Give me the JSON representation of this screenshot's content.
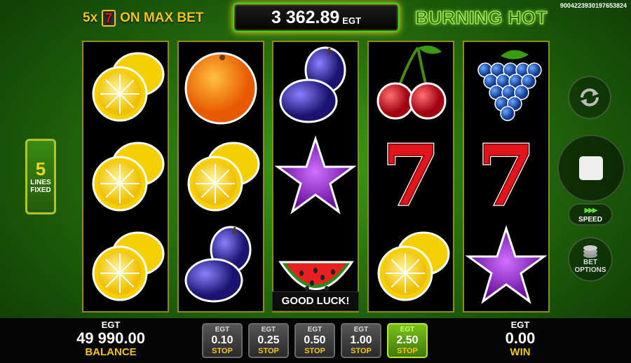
{
  "header": {
    "max_bet_prefix": "5x",
    "max_bet_seven": "7",
    "max_bet_suffix": "ON MAX BET",
    "credit_value": "3 362.89",
    "credit_currency": "EGT",
    "game_title": "BURNING HOT",
    "game_id": "9004223930197653824"
  },
  "lines_panel": {
    "count": "5",
    "line1": "LINES",
    "line2": "FIXED"
  },
  "reels": [
    [
      "lemon",
      "lemon",
      "lemon"
    ],
    [
      "orange",
      "lemon",
      "plum"
    ],
    [
      "plum",
      "star",
      "watermelon"
    ],
    [
      "cherry",
      "seven",
      "lemon"
    ],
    [
      "grapes",
      "seven",
      "star"
    ]
  ],
  "status_message": "GOOD LUCK!",
  "controls": {
    "speed_label": "SPEED",
    "bet_options_line1": "BET",
    "bet_options_line2": "OPTIONS",
    "autoplay_icon": "autoplay-icon",
    "spin_stop_icon": "stop-icon"
  },
  "bottom": {
    "balance_currency": "EGT",
    "balance_amount": "49 990.00",
    "balance_label": "BALANCE",
    "win_currency": "EGT",
    "win_amount": "0.00",
    "win_label": "WIN",
    "bet_buttons": [
      {
        "currency": "EGT",
        "value": "0.10",
        "action": "STOP",
        "active": false
      },
      {
        "currency": "EGT",
        "value": "0.25",
        "action": "STOP",
        "active": false
      },
      {
        "currency": "EGT",
        "value": "0.50",
        "action": "STOP",
        "active": false
      },
      {
        "currency": "EGT",
        "value": "1.00",
        "action": "STOP",
        "active": false
      },
      {
        "currency": "EGT",
        "value": "2.50",
        "action": "STOP",
        "active": true
      }
    ]
  },
  "colors": {
    "accent_yellow": "#f2c41a",
    "accent_green": "#38d126",
    "reel_border": "#8f8a1a"
  }
}
